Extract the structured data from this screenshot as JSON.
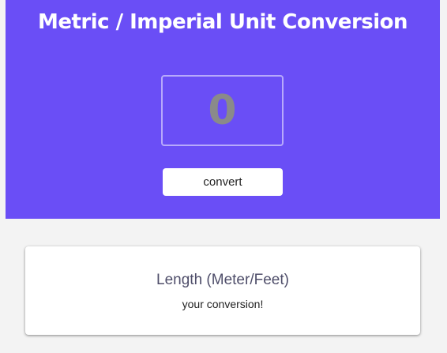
{
  "header": {
    "title": "Metric / Imperial Unit Conversion"
  },
  "converter": {
    "input_value": "0",
    "convert_label": "convert"
  },
  "result_card": {
    "title": "Length (Meter/Feet)",
    "result_text": "your conversion!"
  },
  "colors": {
    "hero_background": "#6a4ef6",
    "page_background": "#f3f3f3",
    "card_background": "#ffffff",
    "input_border": "#b7a9fb"
  }
}
